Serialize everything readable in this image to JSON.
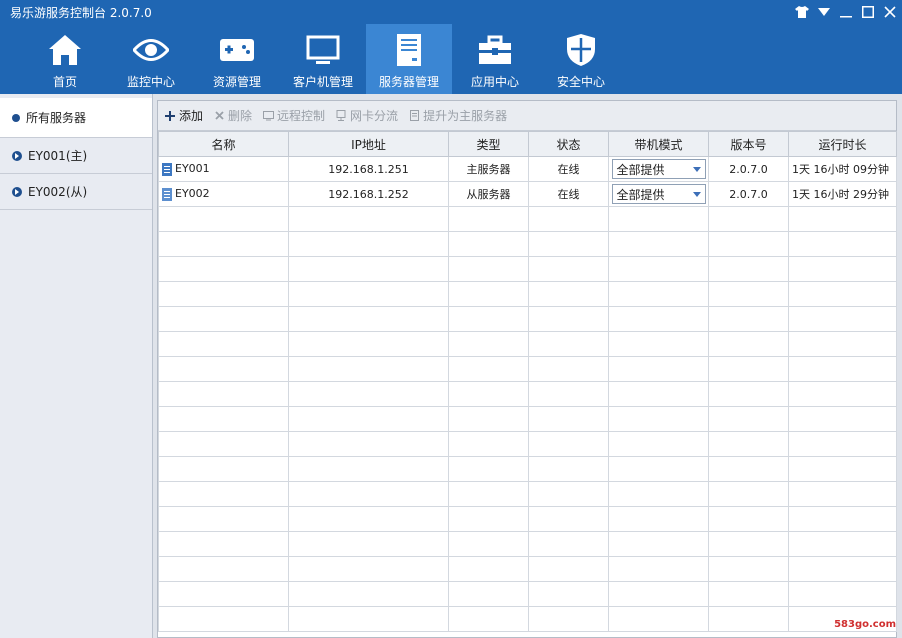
{
  "window": {
    "title": "易乐游服务控制台 2.0.7.0"
  },
  "nav": {
    "items": [
      {
        "label": "首页",
        "icon": "home-icon"
      },
      {
        "label": "监控中心",
        "icon": "eye-icon"
      },
      {
        "label": "资源管理",
        "icon": "gamepad-icon"
      },
      {
        "label": "客户机管理",
        "icon": "monitor-icon"
      },
      {
        "label": "服务器管理",
        "icon": "server-icon",
        "active": true
      },
      {
        "label": "应用中心",
        "icon": "toolbox-icon"
      },
      {
        "label": "安全中心",
        "icon": "shield-icon"
      }
    ]
  },
  "sidebar": {
    "items": [
      {
        "label": "所有服务器"
      },
      {
        "label": "EY001(主)"
      },
      {
        "label": "EY002(从)"
      }
    ]
  },
  "toolbar": {
    "add_label": "添加",
    "delete_label": "删除",
    "remote_label": "远程控制",
    "nic_label": "网卡分流",
    "promote_label": "提升为主服务器"
  },
  "table": {
    "headers": [
      "名称",
      "IP地址",
      "类型",
      "状态",
      "带机模式",
      "版本号",
      "运行时长"
    ],
    "rows": [
      {
        "name": "EY001",
        "ip": "192.168.1.251",
        "type": "主服务器",
        "status": "在线",
        "mode": "全部提供",
        "version": "2.0.7.0",
        "runtime": "1天 16小时 09分钟"
      },
      {
        "name": "EY002",
        "ip": "192.168.1.252",
        "type": "从服务器",
        "status": "在线",
        "mode": "全部提供",
        "version": "2.0.7.0",
        "runtime": "1天 16小时 29分钟"
      }
    ]
  },
  "watermark": "583go.com",
  "colors": {
    "header": "#1f66b3",
    "active_tab": "#3b86d3"
  }
}
